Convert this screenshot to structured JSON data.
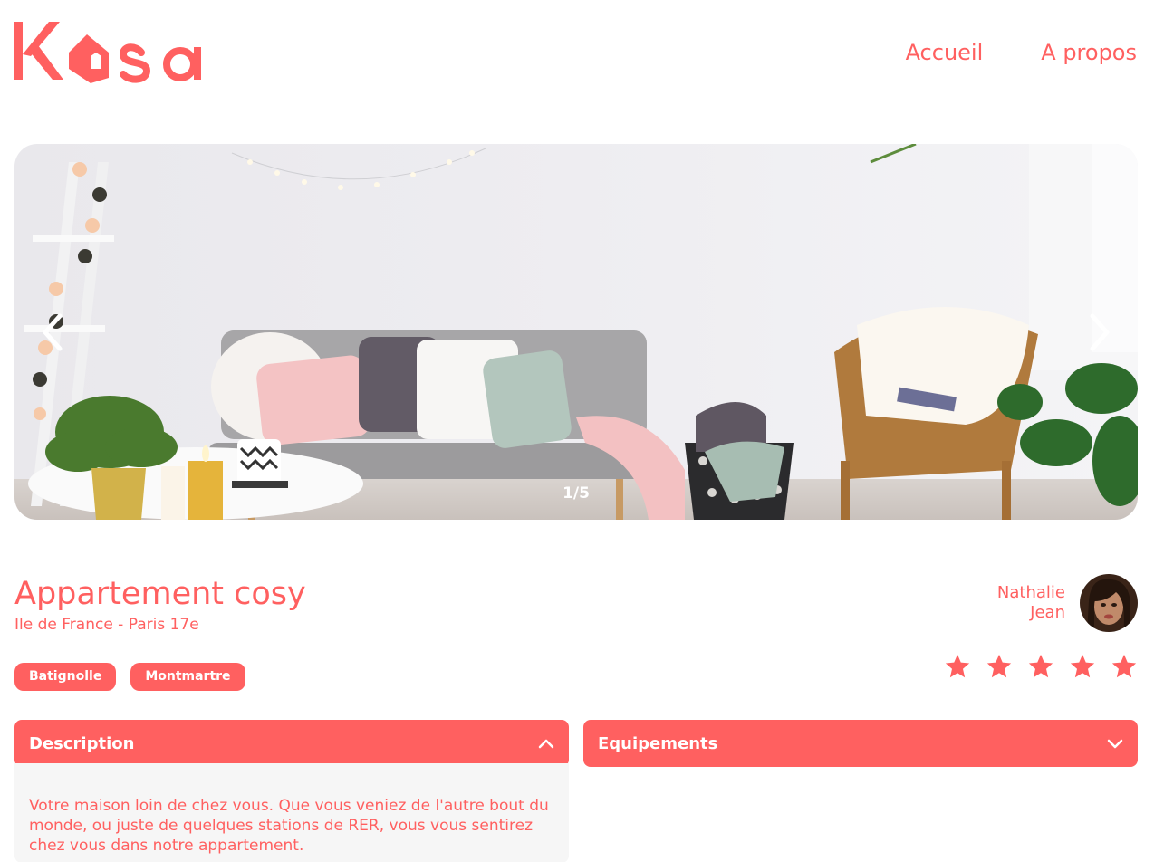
{
  "header": {
    "logo_text": "Kasa",
    "nav": [
      {
        "label": "Accueil"
      },
      {
        "label": "A propos"
      }
    ]
  },
  "carousel": {
    "counter": "1/5",
    "current": 1,
    "total": 5
  },
  "listing": {
    "title": "Appartement cosy",
    "location": "Ile de France - Paris 17e",
    "tags": [
      "Batignolle",
      "Montmartre"
    ],
    "host": {
      "first_name": "Nathalie",
      "last_name": "Jean"
    },
    "rating": 5,
    "rating_max": 5
  },
  "collapses": {
    "description": {
      "label": "Description",
      "expanded": true,
      "text": "Votre maison loin de chez vous. Que vous veniez de l'autre bout du monde, ou juste de quelques stations de RER, vous vous sentirez chez vous dans notre appartement."
    },
    "equipements": {
      "label": "Equipements",
      "expanded": false
    }
  },
  "colors": {
    "accent": "#FF6060",
    "panel": "#F6F6F6"
  }
}
